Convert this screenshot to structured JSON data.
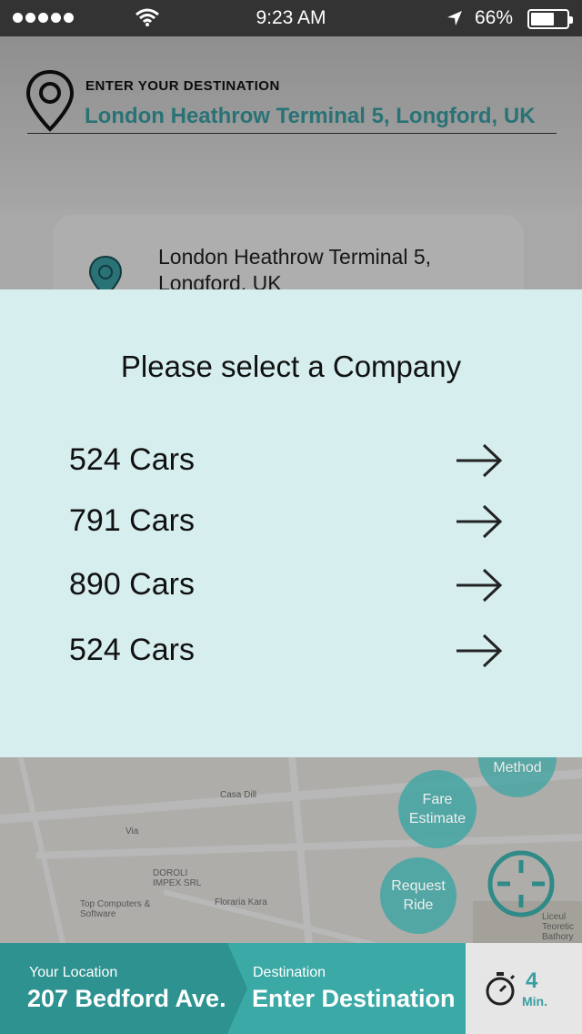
{
  "status_bar": {
    "time": "9:23 AM",
    "battery": "66%",
    "battery_level": 0.66
  },
  "header": {
    "title": "ENTER YOUR DESTINATION",
    "value": "London Heathrow Terminal 5, Longford, UK"
  },
  "suggestion": {
    "text": "London Heathrow Terminal 5, Longford, UK"
  },
  "map_labels": [
    "Casa Dill",
    "Via",
    "DOROLI IMPEX SRL",
    "Top Computers & Software",
    "Floraria Kara",
    "Liceul Teoretic Bathory Istvan"
  ],
  "buttons": {
    "payment": "Payment Method",
    "fare": "Fare Estimate",
    "request": "Request Ride"
  },
  "bottom_bar": {
    "location_label": "Your Location",
    "location_value": "207 Bedford Ave.",
    "destination_label": "Destination",
    "destination_value": "Enter Destination",
    "eta_value": "4",
    "eta_unit": "Min."
  },
  "modal": {
    "title": "Please select a Company",
    "companies": [
      {
        "label": "524 Cars"
      },
      {
        "label": "791 Cars"
      },
      {
        "label": "890 Cars"
      },
      {
        "label": "524 Cars"
      }
    ]
  },
  "colors": {
    "accent": "#3a9fa3",
    "modal_bg": "#d6eeee",
    "status_bar": "#333333"
  }
}
